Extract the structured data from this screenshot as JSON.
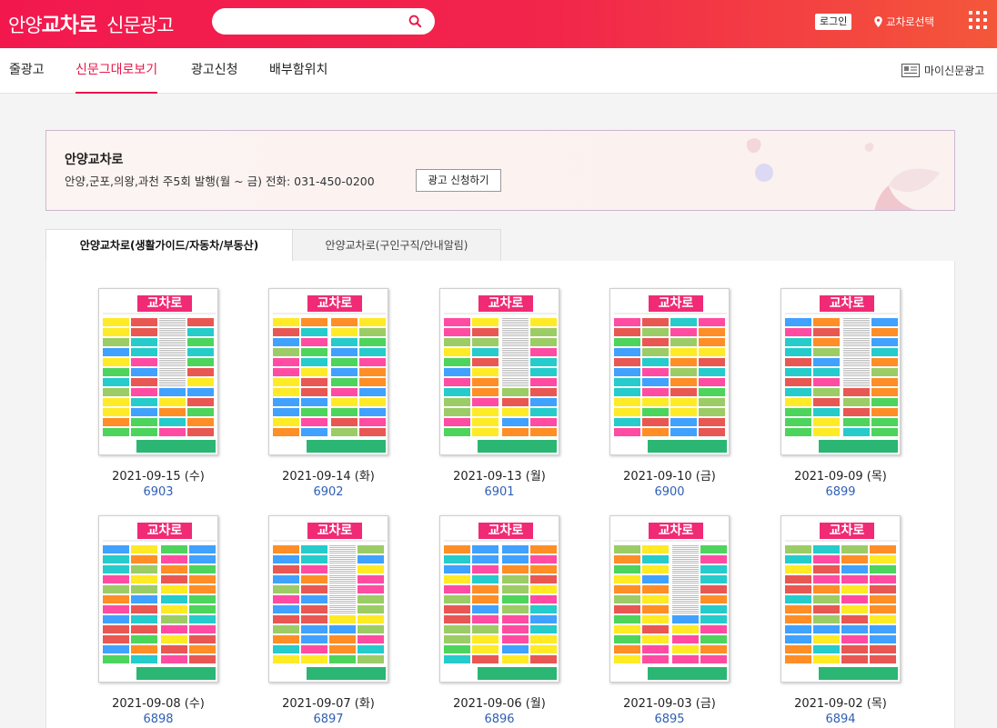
{
  "header": {
    "logo_part1": "안양",
    "logo_part2": "교차로",
    "logo_part3": "신문광고",
    "search_placeholder": "",
    "login_label": "로그인",
    "region_label": "교차로선택",
    "brand_color": "#f2184e"
  },
  "nav": {
    "items": [
      "줄광고",
      "신문그대로보기",
      "광고신청",
      "배부함위치"
    ],
    "active_index": 1,
    "my_paper_label": "마이신문광고"
  },
  "info": {
    "title": "안양교차로",
    "description": "안양,군포,의왕,과천 주5회 발행(월 ~ 금) 전화: 031-450-0200",
    "apply_button": "광고 신청하기"
  },
  "tabs": [
    {
      "label": "안양교차로(생활가이드/자동차/부동산)",
      "active": true
    },
    {
      "label": "안양교차로(구인구직/안내알림)",
      "active": false
    }
  ],
  "issues": [
    {
      "date": "2021-09-15 (수)",
      "number": "6903",
      "masthead": "교차로"
    },
    {
      "date": "2021-09-14 (화)",
      "number": "6902",
      "masthead": "교차로"
    },
    {
      "date": "2021-09-13 (월)",
      "number": "6901",
      "masthead": "교차로"
    },
    {
      "date": "2021-09-10 (금)",
      "number": "6900",
      "masthead": "교차로"
    },
    {
      "date": "2021-09-09 (목)",
      "number": "6899",
      "masthead": "교차로"
    },
    {
      "date": "2021-09-08 (수)",
      "number": "6898",
      "masthead": "교차로"
    },
    {
      "date": "2021-09-07 (화)",
      "number": "6897",
      "masthead": "교차로"
    },
    {
      "date": "2021-09-06 (월)",
      "number": "6896",
      "masthead": "교차로"
    },
    {
      "date": "2021-09-03 (금)",
      "number": "6895",
      "masthead": "교차로"
    },
    {
      "date": "2021-09-02 (목)",
      "number": "6894",
      "masthead": "교차로"
    }
  ]
}
